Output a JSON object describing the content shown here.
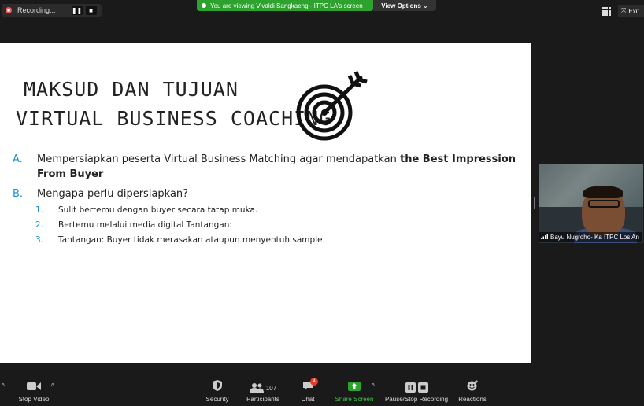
{
  "topbar": {
    "recording_label": "Recording...",
    "viewing_banner": "You are viewing Vivaldi Sangkaeng - ITPC LA's screen",
    "view_options": "View Options",
    "exit_label": "Exit"
  },
  "slide": {
    "title_line1": "MAKSUD DAN TUJUAN",
    "title_line2": "VIRTUAL BUSINESS COACHING",
    "item_a_marker": "A.",
    "item_a_text": "Mempersiapkan peserta Virtual Business Matching agar mendapatkan ",
    "item_a_bold": "the Best Impression From Buyer",
    "item_b_marker": "B.",
    "item_b_text": "Mengapa perlu dipersiapkan?",
    "subitems": [
      {
        "marker": "1.",
        "text": "Sulit bertemu dengan buyer secara tatap muka."
      },
      {
        "marker": "2.",
        "text": "Bertemu melalui media digital Tantangan:"
      },
      {
        "marker": "3.",
        "text": "Tantangan: Buyer tidak merasakan ataupun menyentuh sample."
      }
    ]
  },
  "participant_video": {
    "name": "Bayu Nugroho- Ka ITPC Los An"
  },
  "toolbar": {
    "stop_video": "Stop Video",
    "security": "Security",
    "participants": "Participants",
    "participants_count": "107",
    "chat": "Chat",
    "chat_badge": "4",
    "share_screen": "Share Screen",
    "pause_recording": "Pause/Stop Recording",
    "reactions": "Reactions"
  },
  "colors": {
    "accent_blue": "#1f8ed0",
    "share_green": "#2ea22e",
    "badge_red": "#e23b2e"
  }
}
